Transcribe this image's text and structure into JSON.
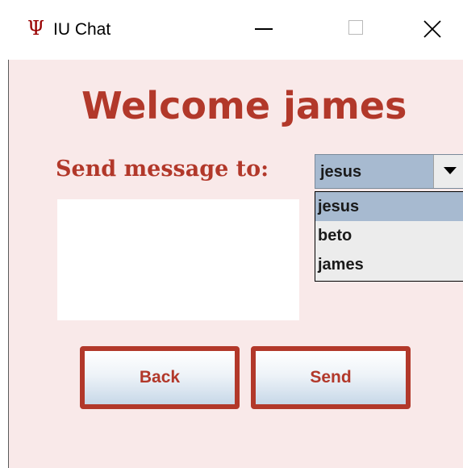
{
  "window": {
    "app_icon": "Ψ",
    "title": "IU Chat",
    "controls": [
      "minimize",
      "maximize",
      "close"
    ]
  },
  "main": {
    "welcome_text": "Welcome james",
    "send_to_label": "Send message to:",
    "recipient_select": {
      "selected": "jesus",
      "options": [
        "jesus",
        "beto",
        "james"
      ],
      "highlighted_index": 0
    },
    "message_text": "",
    "back_label": "Back",
    "send_label": "Send"
  },
  "colors": {
    "accent": "#b2382a",
    "background": "#f9e9e9",
    "selection": "#a7bad0"
  }
}
